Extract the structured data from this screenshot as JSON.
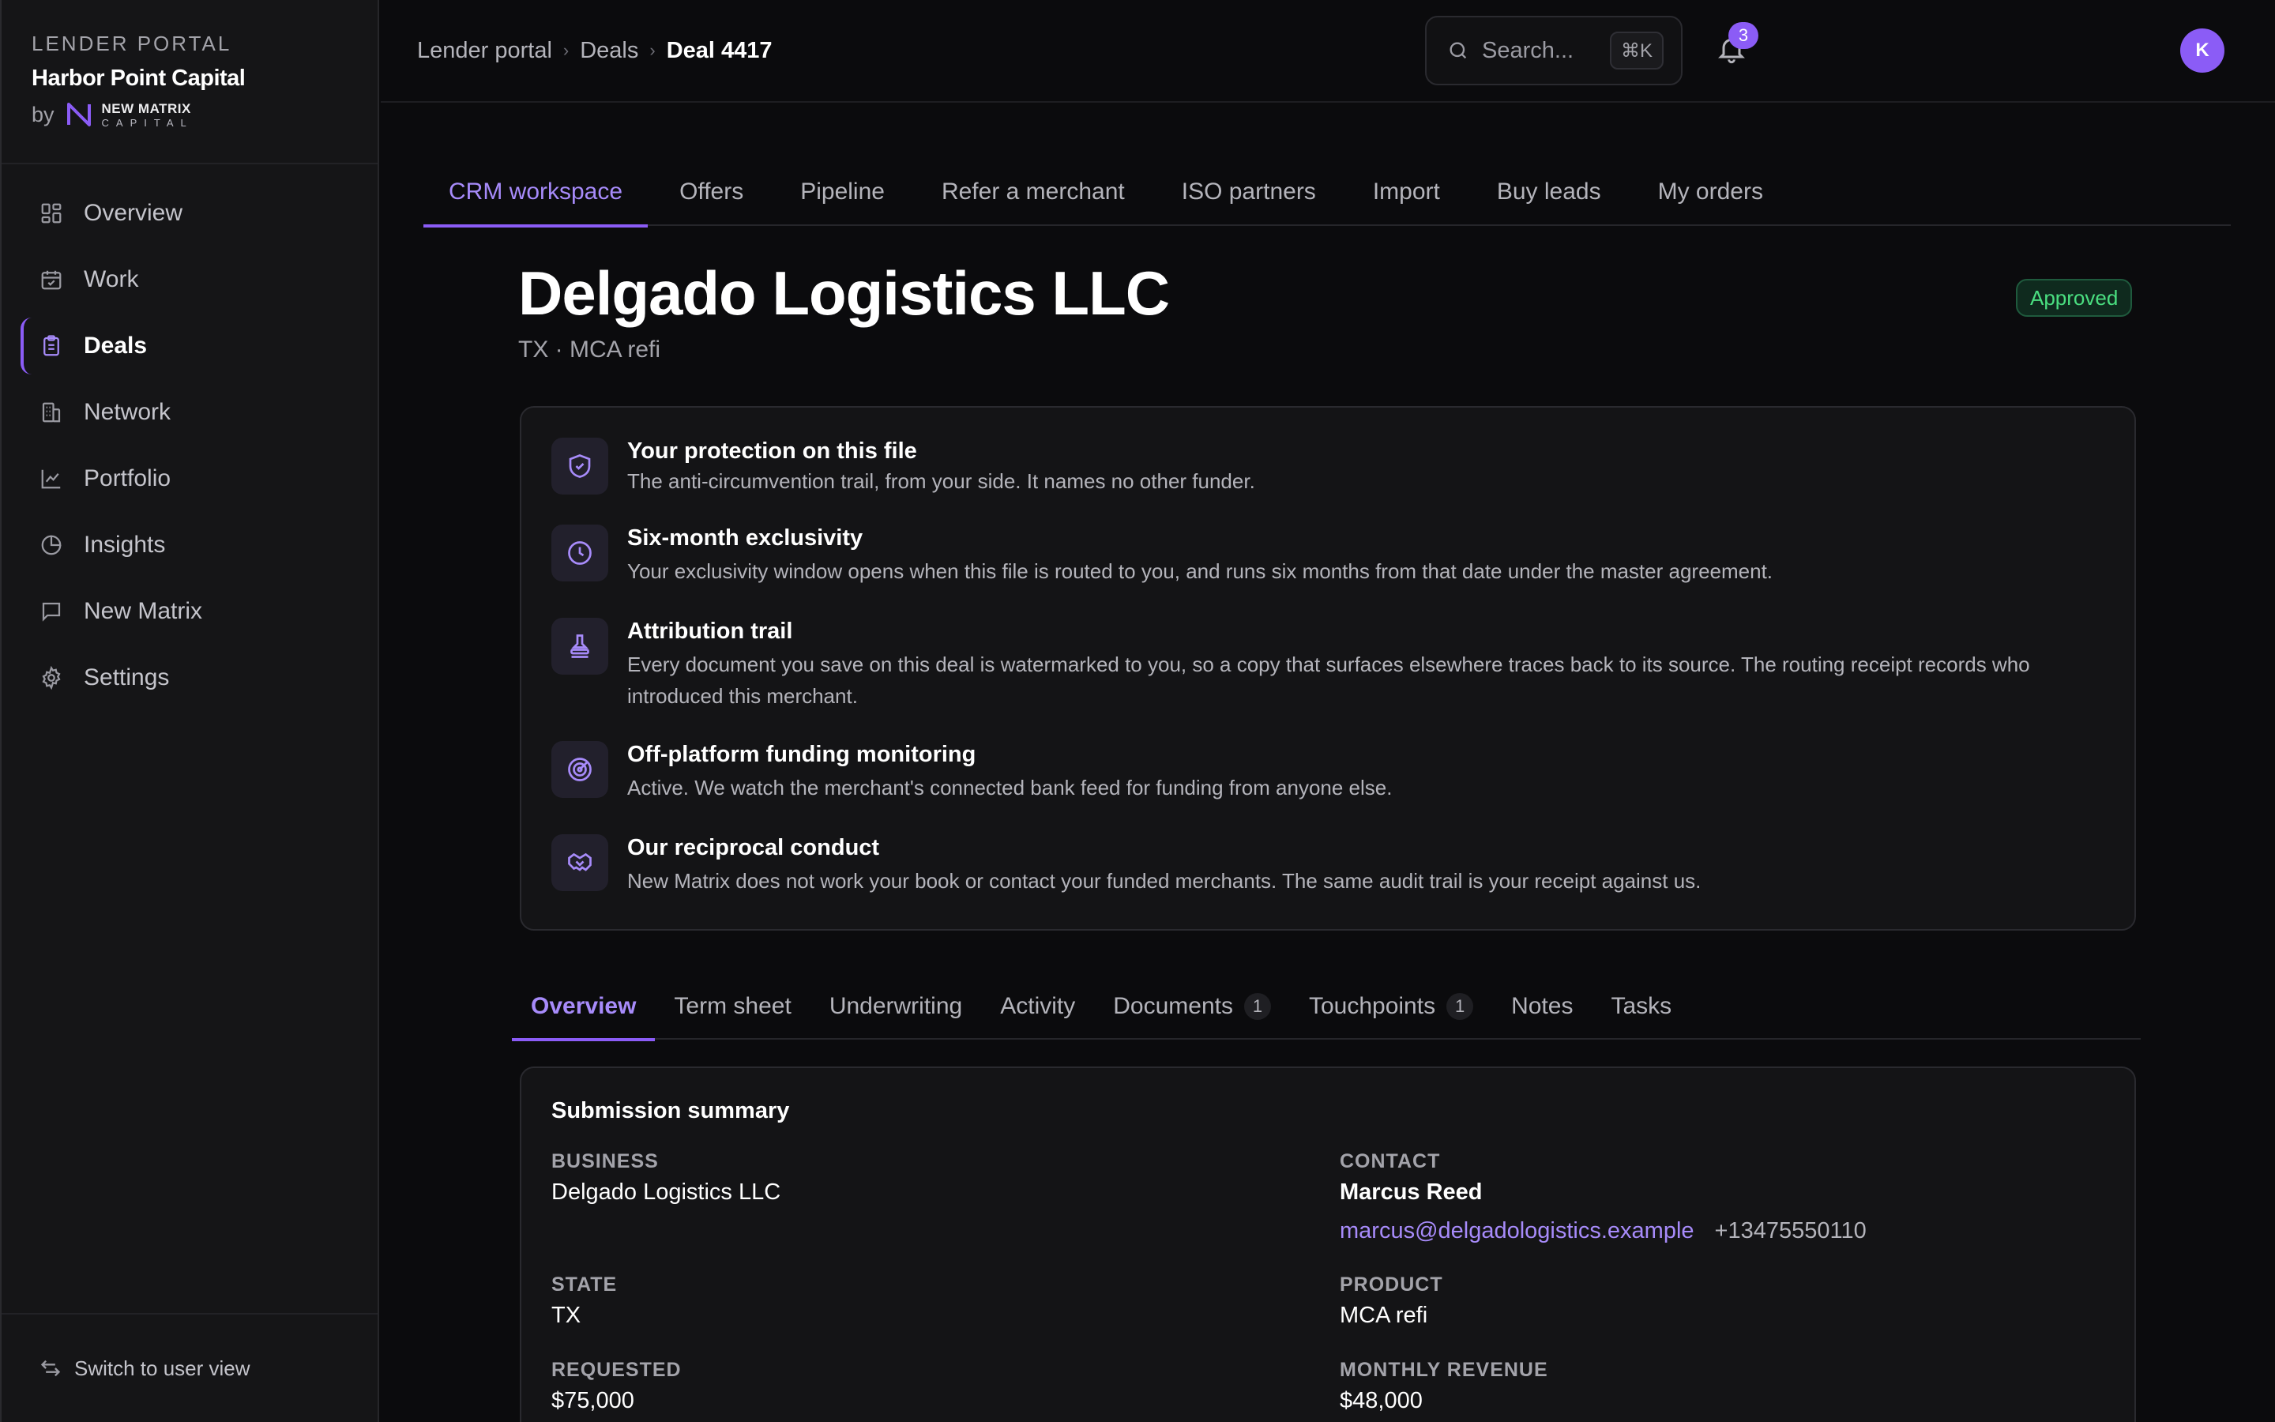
{
  "sidebar": {
    "eyebrow": "LENDER PORTAL",
    "company": "Harbor Point Capital",
    "by": "by",
    "logo_top": "NEW MATRIX",
    "logo_bottom": "CAPITAL",
    "items": [
      {
        "label": "Overview",
        "icon": "grid-icon"
      },
      {
        "label": "Work",
        "icon": "calendar-check-icon"
      },
      {
        "label": "Deals",
        "icon": "clipboard-icon"
      },
      {
        "label": "Network",
        "icon": "building-icon"
      },
      {
        "label": "Portfolio",
        "icon": "line-chart-icon"
      },
      {
        "label": "Insights",
        "icon": "pie-chart-icon"
      },
      {
        "label": "New Matrix",
        "icon": "message-square-icon"
      },
      {
        "label": "Settings",
        "icon": "gear-icon"
      }
    ],
    "active": "Deals",
    "footer": "Switch to user view"
  },
  "topbar": {
    "breadcrumbs": [
      "Lender portal",
      "Deals",
      "Deal 4417"
    ],
    "search_placeholder": "Search...",
    "shortcut": "⌘K",
    "notifications": "3",
    "avatar_initial": "K"
  },
  "tabs": [
    "CRM workspace",
    "Offers",
    "Pipeline",
    "Refer a merchant",
    "ISO partners",
    "Import",
    "Buy leads",
    "My orders"
  ],
  "active_tab": "CRM workspace",
  "deal": {
    "title": "Delgado Logistics LLC",
    "subtitle": "TX · MCA refi",
    "status": "Approved"
  },
  "protection": [
    {
      "icon": "shield-check-icon",
      "title": "Your protection on this file",
      "desc": "The anti-circumvention trail, from your side. It names no other funder."
    },
    {
      "icon": "clock-icon",
      "title": "Six-month exclusivity",
      "desc": "Your exclusivity window opens when this file is routed to you, and runs six months from that date under the master agreement."
    },
    {
      "icon": "stamp-icon",
      "title": "Attribution trail",
      "desc": "Every document you save on this deal is watermarked to you, so a copy that surfaces elsewhere traces back to its source. The routing receipt records who introduced this merchant."
    },
    {
      "icon": "radar-icon",
      "title": "Off-platform funding monitoring",
      "desc": "Active. We watch the merchant's connected bank feed for funding from anyone else."
    },
    {
      "icon": "handshake-icon",
      "title": "Our reciprocal conduct",
      "desc": "New Matrix does not work your book or contact your funded merchants. The same audit trail is your receipt against us."
    }
  ],
  "subtabs": [
    {
      "label": "Overview",
      "count": ""
    },
    {
      "label": "Term sheet",
      "count": ""
    },
    {
      "label": "Underwriting",
      "count": ""
    },
    {
      "label": "Activity",
      "count": ""
    },
    {
      "label": "Documents",
      "count": "1"
    },
    {
      "label": "Touchpoints",
      "count": "1"
    },
    {
      "label": "Notes",
      "count": ""
    },
    {
      "label": "Tasks",
      "count": ""
    }
  ],
  "active_subtab": "Overview",
  "summary": {
    "title": "Submission summary",
    "business_label": "BUSINESS",
    "business": "Delgado Logistics LLC",
    "contact_label": "CONTACT",
    "contact_name": "Marcus Reed",
    "contact_email": "marcus@delgadologistics.example",
    "contact_phone": "+13475550110",
    "state_label": "STATE",
    "state": "TX",
    "product_label": "PRODUCT",
    "product": "MCA refi",
    "requested_label": "REQUESTED",
    "requested": "$75,000",
    "revenue_label": "MONTHLY REVENUE",
    "revenue": "$48,000"
  },
  "colors": {
    "accent": "#8b5cf6",
    "accent_text": "#a78bfa",
    "approved": "#4ade80",
    "background": "#0b0b0d",
    "card": "#141416"
  }
}
